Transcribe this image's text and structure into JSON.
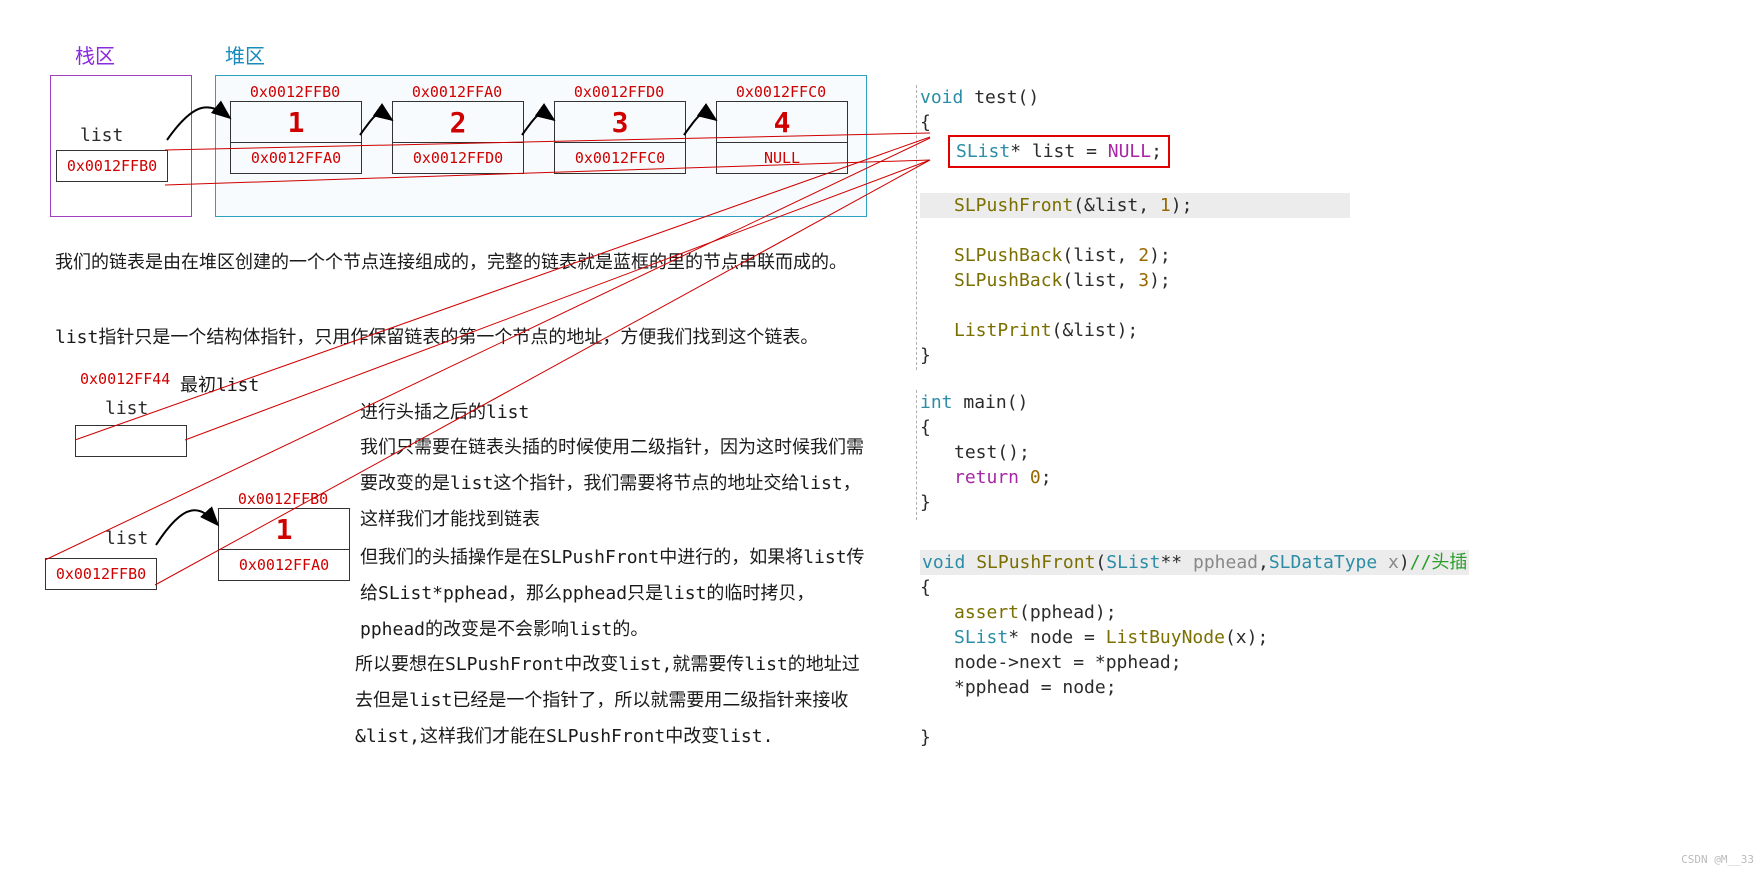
{
  "labels": {
    "stack_zone": "栈区",
    "heap_zone": "堆区",
    "list": "list",
    "initial_list": "最初list",
    "after_push_list": "进行头插之后的list"
  },
  "stack": {
    "list_ptr_addr": "0x0012FFB0"
  },
  "heap_nodes": [
    {
      "addr": "0x0012FFB0",
      "value": "1",
      "next": "0x0012FFA0"
    },
    {
      "addr": "0x0012FFA0",
      "value": "2",
      "next": "0x0012FFD0"
    },
    {
      "addr": "0x0012FFD0",
      "value": "3",
      "next": "0x0012FFC0"
    },
    {
      "addr": "0x0012FFC0",
      "value": "4",
      "next": "NULL"
    }
  ],
  "paragraphs": {
    "p1": "我们的链表是由在堆区创建的一个个节点连接组成的，完整的链表就是蓝框的里的节点串联而成的。",
    "p2": "list指针只是一个结构体指针，只用作保留链表的第一个节点的地址，方便我们找到这个链表。"
  },
  "initial": {
    "addr_top": "0x0012FF44"
  },
  "after_push": {
    "list_ptr_addr": "0x0012FFB0",
    "node": {
      "addr": "0x0012FFB0",
      "value": "1",
      "next": "0x0012FFA0"
    }
  },
  "explain": {
    "l1": "我们只需要在链表头插的时候使用二级指针，因为这时候我们需要改变的是list这个指针，我们需要将节点的地址交给list，这样我们才能找到链表",
    "l2": "但我们的头插操作是在SLPushFront中进行的，如果将list传给SList*pphead，那么pphead只是list的临时拷贝，pphead的改变是不会影响list的。",
    "l3": " 所以要想在SLPushFront中改变list,就需要传list的地址过去但是list已经是一个指针了，所以就需要用二级指针来接收&list,这样我们才能在SLPushFront中改变list."
  },
  "code_test": {
    "sig_void": "void",
    "sig_name": "test()",
    "decl_type": "SList",
    "decl_star": "*",
    "decl_name": "list",
    "decl_eq": " = ",
    "decl_null": "NULL",
    "semi": ";",
    "call1a": "SLPushFront",
    "call1b": "(&list, ",
    "call1n": "1",
    "call1c": ");",
    "call2a": "SLPushBack",
    "call2b": "(list, ",
    "call2n": "2",
    "call2c": ");",
    "call3a": "SLPushBack",
    "call3b": "(list, ",
    "call3n": "3",
    "call3c": ");",
    "call4a": "ListPrint",
    "call4b": "(&list);"
  },
  "code_main": {
    "int": "int",
    "main": "main()",
    "call_test": "test();",
    "ret": "return",
    "zero": "0",
    "semi": ";"
  },
  "code_pushfront": {
    "void": "void",
    "name": "SLPushFront",
    "paren_open": "(",
    "param1_type": "SList",
    "param1_stars": "**",
    "param1_name": " pphead",
    "comma": ",",
    "param2_type": "SLDataType",
    "param2_name": " x",
    "paren_close": ")",
    "comment": "//头插",
    "body1a": "assert",
    "body1b": "(pphead);",
    "body2_type": "SList",
    "body2_star": "*",
    "body2_name": " node = ",
    "body2_call": "ListBuyNode",
    "body2_arg": "(x);",
    "body3": "node->next = *pphead;",
    "body4": "*pphead = node;"
  },
  "watermark": "CSDN @M__33"
}
